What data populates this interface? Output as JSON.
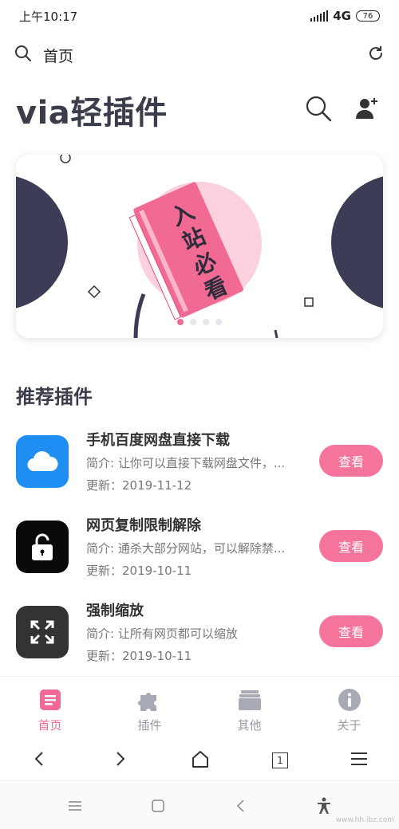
{
  "status_bar": {
    "time": "上午10:17",
    "network": "4G",
    "battery": "76"
  },
  "address_bar": {
    "title": "首页",
    "search_icon": "search-icon",
    "refresh_icon": "refresh-icon"
  },
  "header": {
    "title": "via轻插件"
  },
  "banner": {
    "book_text": "入站必看",
    "slide_count": 4,
    "active_slide": 1
  },
  "section": {
    "title": "推荐插件"
  },
  "plugins": [
    {
      "name": "手机百度网盘直接下载",
      "desc": "简介: 让你可以直接下载网盘文件，...",
      "date": "更新：2019-11-12",
      "button": "查看",
      "icon": "cloud-icon",
      "icon_bg": "#1e8ef2"
    },
    {
      "name": "网页复制限制解除",
      "desc": "简介: 通杀大部分网站，可以解除禁...",
      "date": "更新：2019-10-11",
      "button": "查看",
      "icon": "unlock-icon",
      "icon_bg": "#0a0a0a"
    },
    {
      "name": "强制缩放",
      "desc": "简介: 让所有网页都可以缩放",
      "date": "更新：2019-10-11",
      "button": "查看",
      "icon": "expand-icon",
      "icon_bg": "#333333"
    }
  ],
  "tabs": [
    {
      "label": "首页",
      "icon": "document-icon",
      "active": true
    },
    {
      "label": "插件",
      "icon": "puzzle-icon",
      "active": false
    },
    {
      "label": "其他",
      "icon": "folder-icon",
      "active": false
    },
    {
      "label": "关于",
      "icon": "info-icon",
      "active": false
    }
  ],
  "browser_nav": {
    "tab_count": "1"
  },
  "watermark": "www.hh.ibz.com",
  "colors": {
    "accent": "#f06a94",
    "title": "#3b3d4a",
    "button": "#f4749c"
  }
}
